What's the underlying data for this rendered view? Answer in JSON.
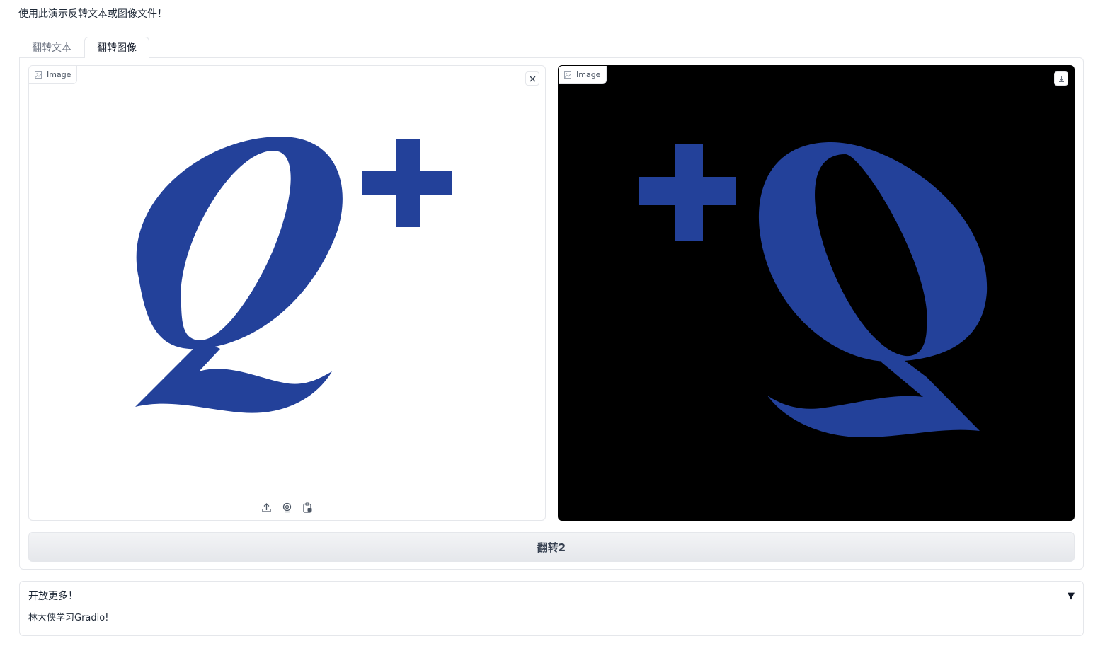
{
  "intro_text": "使用此演示反转文本或图像文件！",
  "tabs": [
    {
      "label": "翻转文本",
      "active": false
    },
    {
      "label": "翻转图像",
      "active": true
    }
  ],
  "input_image": {
    "label": "Image",
    "clear_icon": "close-icon",
    "toolbar": [
      "upload-icon",
      "webcam-icon",
      "clipboard-icon"
    ]
  },
  "output_image": {
    "label": "Image",
    "download_icon": "download-icon"
  },
  "flip_button": {
    "label": "翻转2"
  },
  "accordion": {
    "title": "开放更多！",
    "arrow": "▼",
    "content": "林大侠学习Gradio!"
  },
  "colors": {
    "logo_blue": "#23419a",
    "output_bg": "#000000",
    "border": "#e5e7eb"
  }
}
